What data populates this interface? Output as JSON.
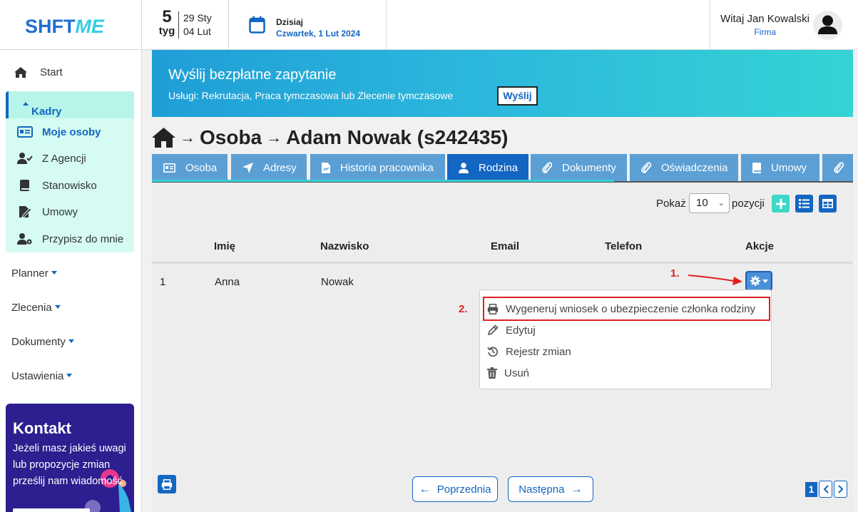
{
  "header": {
    "logo_part1": "SHFT",
    "logo_part2": "ME",
    "week_number": "5",
    "week_label": "tyg",
    "week_start": "29 Sty",
    "week_end": "04 Lut",
    "today_label": "Dzisiaj",
    "today_date": "Czwartek, 1 Lut 2024",
    "user_greeting": "Witaj Jan Kowalski",
    "user_company": "Firma"
  },
  "sidebar": {
    "start": "Start",
    "kadry": "Kadry",
    "kadry_items": [
      "Moje osoby",
      "Z Agencji",
      "Stanowisko",
      "Umowy",
      "Przypisz do mnie"
    ],
    "groups": [
      "Planner",
      "Zlecenia",
      "Dokumenty",
      "Ustawienia"
    ],
    "contact_title": "Kontakt",
    "contact_text": "Jeżeli masz jakieś uwagi lub propozycje zmian prześlij nam wiadomość"
  },
  "banner": {
    "title": "Wyślij bezpłatne zapytanie",
    "text": "Usługi: Rekrutacja, Praca tymczasowa lub Zlecenie tymczasowe",
    "button": "Wyślij"
  },
  "breadcrumb": {
    "level1": "Osoba",
    "level2": "Adam Nowak (s242435)"
  },
  "tabs": [
    "Osoba",
    "Adresy",
    "Historia pracownika",
    "Rodzina",
    "Dokumenty",
    "Oświadczenia",
    "Umowy"
  ],
  "table": {
    "show_label": "Pokaż",
    "show_value": "10",
    "rows_label": "pozycji",
    "columns": [
      "Imię",
      "Nazwisko",
      "Email",
      "Telefon",
      "Akcje"
    ],
    "rows": [
      {
        "no": "1",
        "first_name": "Anna",
        "last_name": "Nowak",
        "email": "",
        "phone": ""
      }
    ]
  },
  "annotations": {
    "step1": "1.",
    "step2": "2."
  },
  "actions_menu": [
    "Wygeneruj wniosek o ubezpieczenie członka rodziny",
    "Edytuj",
    "Rejestr zmian",
    "Usuń"
  ],
  "pagination": {
    "prev": "Poprzednia",
    "next": "Następna",
    "page": "1"
  },
  "colors": {
    "primary": "#1366c2",
    "tab": "#5b9fd4",
    "accent": "#36d1d4",
    "annotation": "#e02020",
    "contact_bg": "#2d1f8f"
  }
}
